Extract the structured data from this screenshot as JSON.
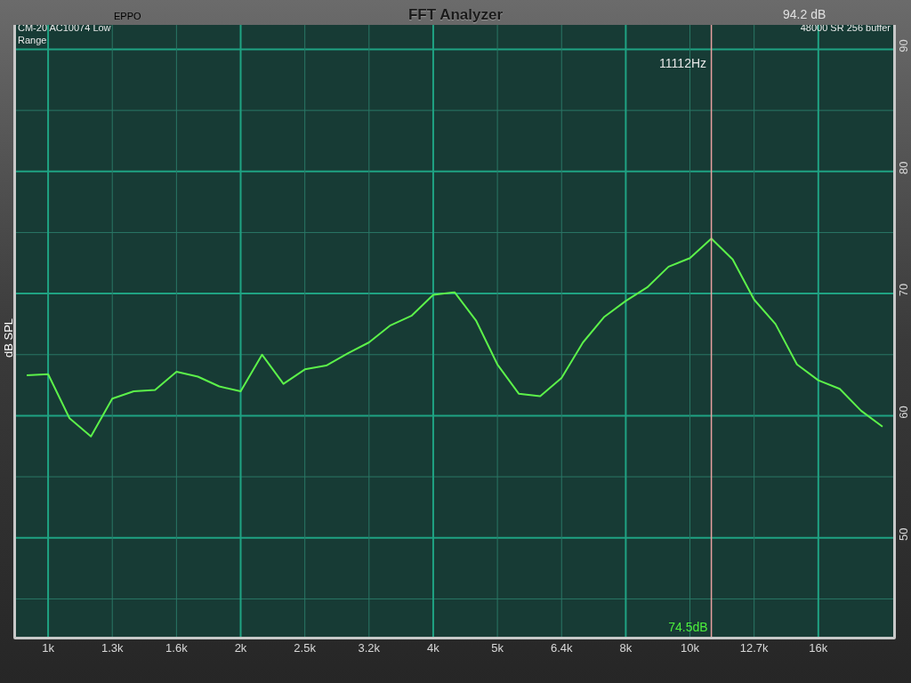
{
  "header": {
    "brand": "EPPO",
    "title": "FFT Analyzer",
    "level_reading": "94.2 dB"
  },
  "analyzer": {
    "device": [
      "CM-20 AC10074 Low",
      "Range"
    ],
    "sample_info": "48000 SR 256 buffer",
    "cursor_reading": "74.5dB",
    "chart_data": {
      "type": "line",
      "grid": true,
      "ylabel": "dB SPL",
      "ylim": [
        41.9,
        92
      ],
      "categories": [
        null,
        "1k",
        null,
        null,
        "1.3k",
        null,
        null,
        "1.6k",
        null,
        null,
        "2k",
        null,
        null,
        "2.5k",
        null,
        null,
        "3.2k",
        null,
        null,
        "4k",
        null,
        null,
        "5k",
        null,
        null,
        "6.4k",
        null,
        null,
        "8k",
        null,
        null,
        "10k",
        null,
        null,
        "12.7k",
        null,
        null,
        "16k",
        null,
        null,
        null
      ],
      "yticks": [
        50,
        60,
        70,
        80,
        90
      ],
      "series": [
        {
          "color": "#5cf24a",
          "values": [
            63.3,
            63.4,
            59.8,
            58.3,
            61.4,
            62.0,
            62.1,
            63.6,
            63.2,
            62.4,
            62.0,
            65.0,
            62.6,
            63.8,
            64.1,
            65.1,
            66.0,
            67.4,
            68.2,
            69.9,
            70.1,
            67.8,
            64.2,
            61.8,
            61.6,
            63.1,
            66.0,
            68.1,
            69.4,
            70.5,
            72.2,
            72.9,
            74.5,
            72.8,
            69.5,
            67.5,
            64.2,
            62.9,
            62.2,
            60.4,
            59.1
          ]
        }
      ],
      "annotations": [
        "11112Hz"
      ]
    }
  }
}
